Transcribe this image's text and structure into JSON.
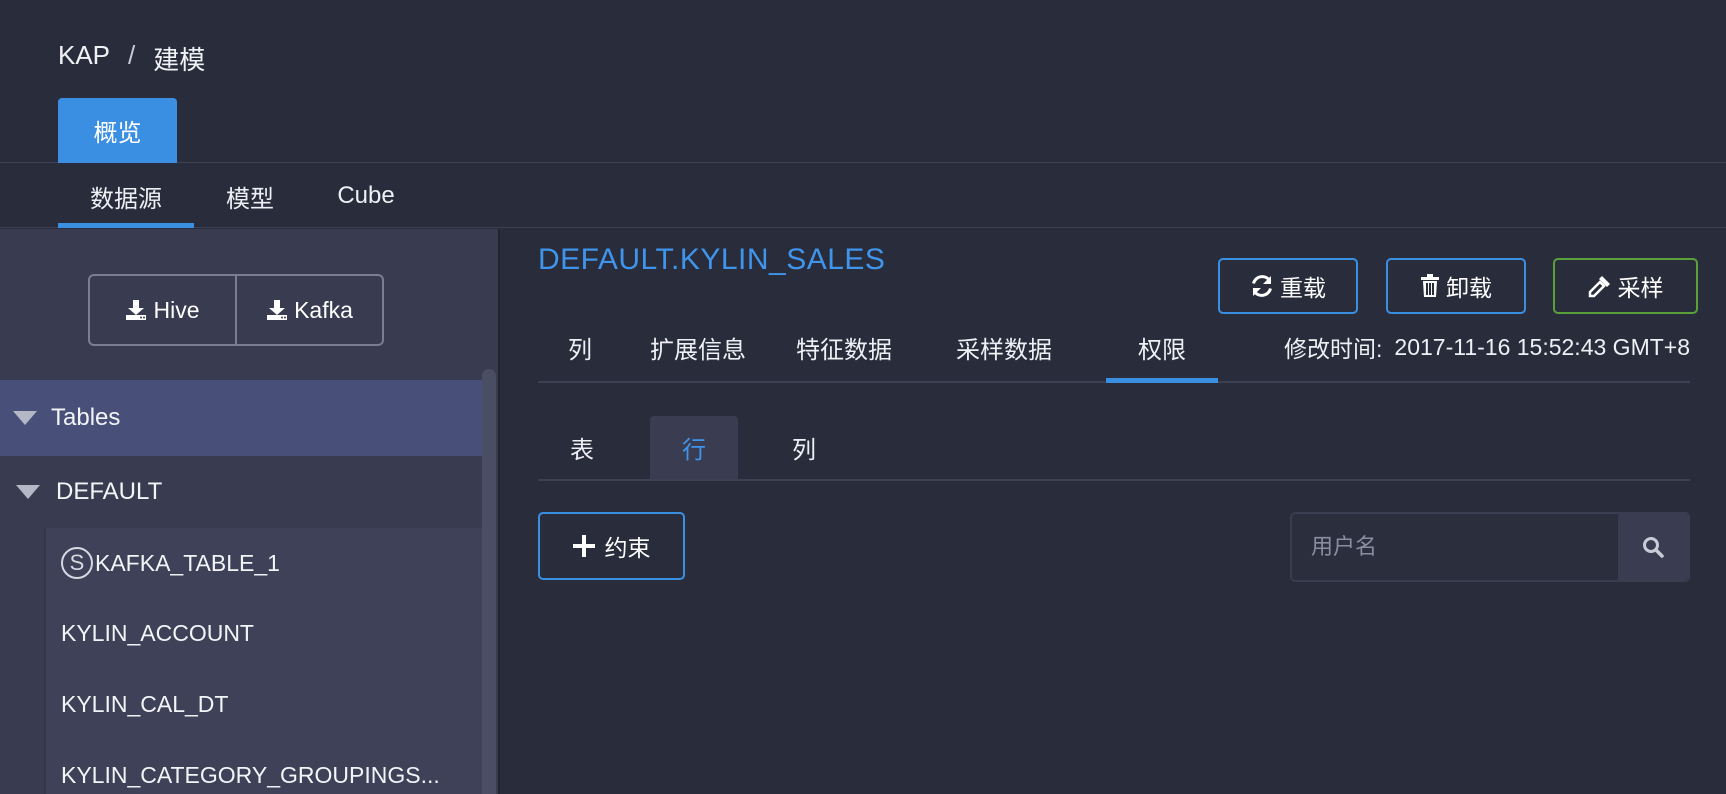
{
  "breadcrumb": {
    "root": "KAP",
    "separator": "/",
    "current": "建模"
  },
  "top_tab": {
    "label": "概览"
  },
  "subnav": {
    "tabs": [
      "数据源",
      "模型",
      "Cube"
    ],
    "active": "数据源"
  },
  "sidebar": {
    "load_buttons": [
      {
        "label": "Hive",
        "icon": "download-icon"
      },
      {
        "label": "Kafka",
        "icon": "download-icon"
      }
    ],
    "tree": {
      "root_label": "Tables",
      "database": "DEFAULT",
      "streaming_marker": "S",
      "tables": [
        "KAFKA_TABLE_1",
        "KYLIN_ACCOUNT",
        "KYLIN_CAL_DT",
        "KYLIN_CATEGORY_GROUPINGS..."
      ]
    }
  },
  "main": {
    "table_name": "DEFAULT.KYLIN_SALES",
    "actions": [
      {
        "label": "重载",
        "icon": "refresh-icon",
        "color": "#3b8fe3"
      },
      {
        "label": "卸载",
        "icon": "trash-icon",
        "color": "#3b8fe3"
      },
      {
        "label": "采样",
        "icon": "eyedropper-icon",
        "color": "#5aa03a"
      }
    ],
    "detail_tabs": [
      "列",
      "扩展信息",
      "特征数据",
      "采样数据",
      "权限"
    ],
    "active_detail_tab": "权限",
    "modified_label": "修改时间:",
    "modified_value": "2017-11-16 15:52:43 GMT+8",
    "permission_tabs": [
      "表",
      "行",
      "列"
    ],
    "active_permission_tab": "行",
    "add_constraint_label": "约束",
    "search_placeholder": "用户名"
  },
  "colors": {
    "accent": "#3b8fe3",
    "success": "#5aa03a",
    "background": "#292c3a",
    "sidebar": "#393c50"
  }
}
